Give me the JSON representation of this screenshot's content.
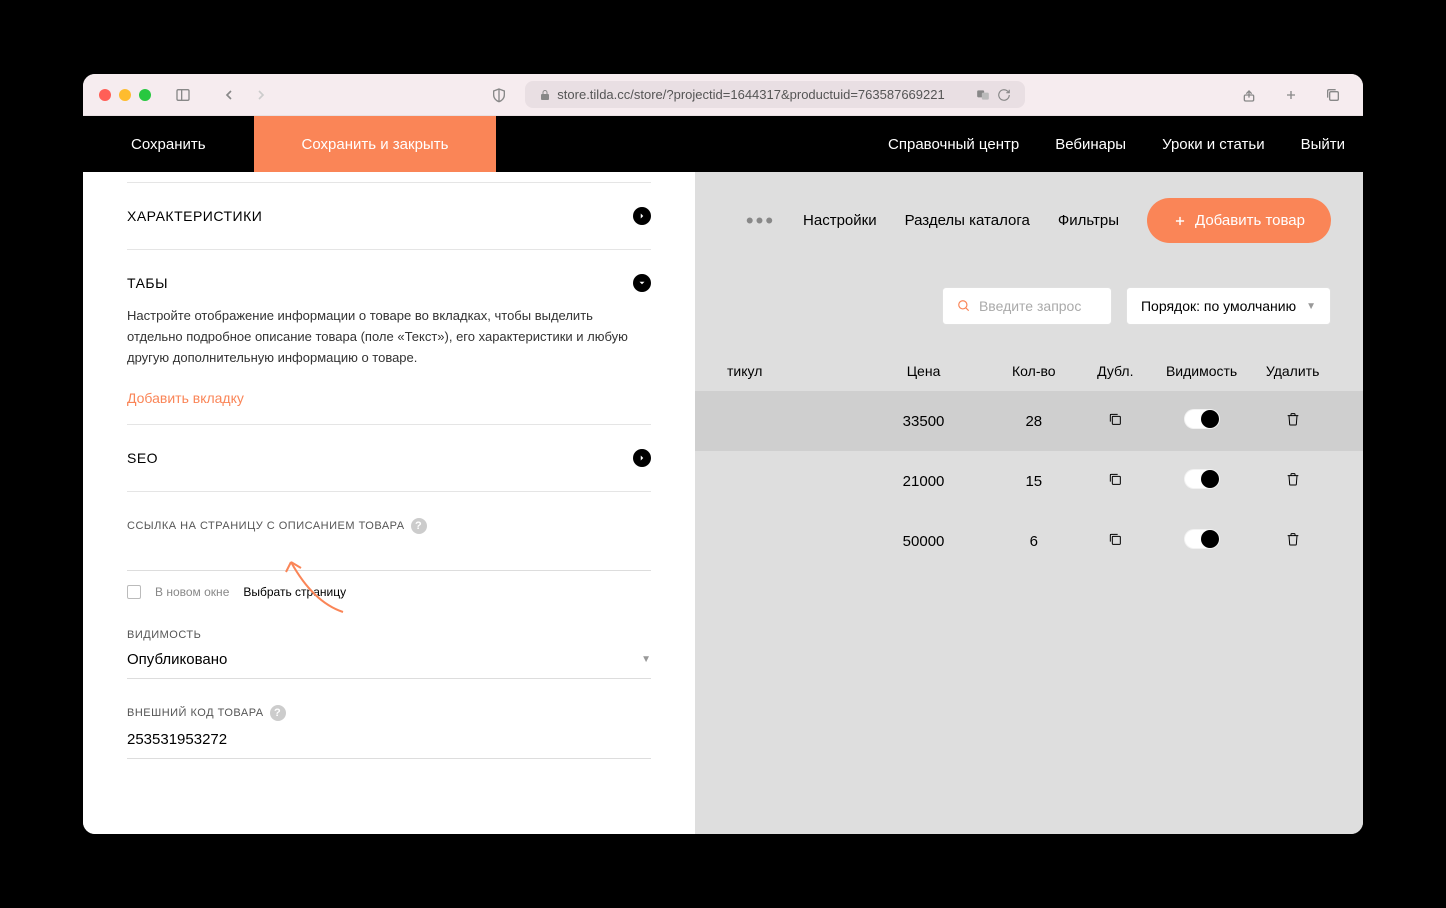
{
  "browser": {
    "url": "store.tilda.cc/store/?projectid=1644317&productuid=763587669221"
  },
  "topnav": {
    "save": "Сохранить",
    "save_close": "Сохранить и закрыть",
    "help_center": "Справочный центр",
    "webinars": "Вебинары",
    "lessons": "Уроки и статьи",
    "logout": "Выйти"
  },
  "panel": {
    "characteristics": "ХАРАКТЕРИСТИКИ",
    "tabs": "ТАБЫ",
    "tabs_desc": "Настройте отображение информации о товаре во вкладках, чтобы выделить отдельно подробное описание товара (поле «Текст»), его характеристики и любую другую дополнительную информацию о товаре.",
    "add_tab": "Добавить вкладку",
    "seo": "SEO",
    "link_label": "ССЫЛКА НА СТРАНИЦУ С ОПИСАНИЕМ ТОВАРА",
    "new_window": "В новом окне",
    "choose_page": "Выбрать страницу",
    "visibility_label": "ВИДИМОСТЬ",
    "visibility_value": "Опубликовано",
    "ext_code_label": "ВНЕШНИЙ КОД ТОВАРА",
    "ext_code_value": "253531953272"
  },
  "catalog": {
    "settings": "Настройки",
    "sections": "Разделы каталога",
    "filters": "Фильтры",
    "add_product": "Добавить товар",
    "search_placeholder": "Введите запрос",
    "order": "Порядок: по умолчанию",
    "headers": {
      "article": "тикул",
      "price": "Цена",
      "qty": "Кол-во",
      "dup": "Дубл.",
      "vis": "Видимость",
      "del": "Удалить"
    },
    "rows": [
      {
        "price": "33500",
        "qty": "28"
      },
      {
        "price": "21000",
        "qty": "15"
      },
      {
        "price": "50000",
        "qty": "6"
      }
    ]
  }
}
